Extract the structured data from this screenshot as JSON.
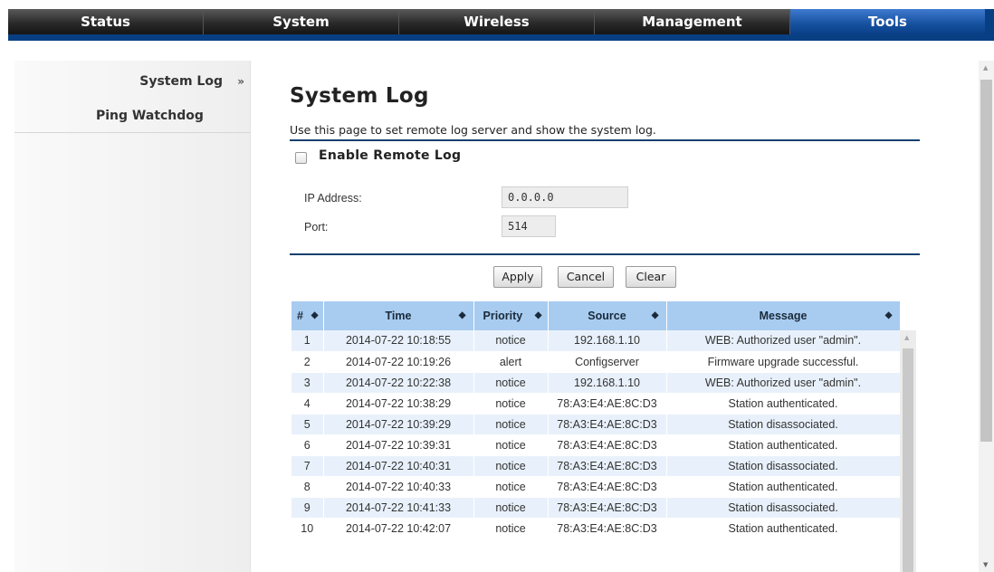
{
  "nav": {
    "tabs": [
      "Status",
      "System",
      "Wireless",
      "Management",
      "Tools"
    ],
    "active": "Tools"
  },
  "sidebar": {
    "items": [
      {
        "label": "System Log",
        "chevron": "»"
      },
      {
        "label": "Ping Watchdog"
      }
    ]
  },
  "page": {
    "title": "System Log",
    "description": "Use this page to set remote log server and show the system log.",
    "enable_remote_log_label": "Enable Remote Log",
    "enable_remote_log_checked": false
  },
  "form": {
    "ip_label": "IP Address:",
    "ip_value": "0.0.0.0",
    "port_label": "Port:",
    "port_value": "514"
  },
  "buttons": {
    "apply": "Apply",
    "cancel": "Cancel",
    "clear": "Clear"
  },
  "log_table": {
    "headers": [
      "#",
      "Time",
      "Priority",
      "Source",
      "Message"
    ],
    "sort_icon": "sort-icon",
    "rows": [
      [
        "1",
        "2014-07-22 10:18:55",
        "notice",
        "192.168.1.10",
        "WEB: Authorized user \"admin\"."
      ],
      [
        "2",
        "2014-07-22 10:19:26",
        "alert",
        "Configserver",
        "Firmware upgrade successful."
      ],
      [
        "3",
        "2014-07-22 10:22:38",
        "notice",
        "192.168.1.10",
        "WEB: Authorized user \"admin\"."
      ],
      [
        "4",
        "2014-07-22 10:38:29",
        "notice",
        "78:A3:E4:AE:8C:D3",
        "Station authenticated."
      ],
      [
        "5",
        "2014-07-22 10:39:29",
        "notice",
        "78:A3:E4:AE:8C:D3",
        "Station disassociated."
      ],
      [
        "6",
        "2014-07-22 10:39:31",
        "notice",
        "78:A3:E4:AE:8C:D3",
        "Station authenticated."
      ],
      [
        "7",
        "2014-07-22 10:40:31",
        "notice",
        "78:A3:E4:AE:8C:D3",
        "Station disassociated."
      ],
      [
        "8",
        "2014-07-22 10:40:33",
        "notice",
        "78:A3:E4:AE:8C:D3",
        "Station authenticated."
      ],
      [
        "9",
        "2014-07-22 10:41:33",
        "notice",
        "78:A3:E4:AE:8C:D3",
        "Station disassociated."
      ],
      [
        "10",
        "2014-07-22 10:42:07",
        "notice",
        "78:A3:E4:AE:8C:D3",
        "Station authenticated."
      ]
    ]
  },
  "colors": {
    "nav_dark": "#2a2a2a",
    "nav_active": "#15509e",
    "header_bar": "#083f82",
    "rule": "#17416f",
    "table_header": "#a8cbf0",
    "table_row_alt": "#e8f1fb"
  }
}
